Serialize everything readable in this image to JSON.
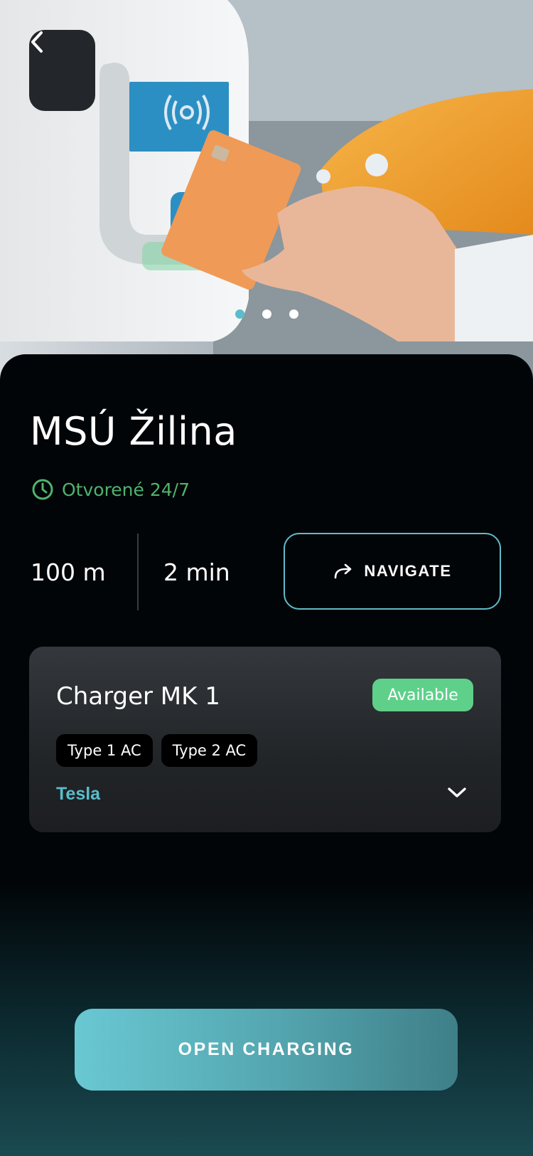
{
  "colors": {
    "accent": "#5bbccb",
    "open_status": "#4fb36d",
    "available_badge": "#5fd08a"
  },
  "hero": {
    "carousel": {
      "total": 3,
      "active_index": 0
    },
    "back_icon": "chevron-left-icon"
  },
  "station": {
    "name": "MSÚ Žilina",
    "hours_icon": "clock-icon",
    "hours": "Otvorené 24/7",
    "distance": "100 m",
    "duration": "2 min"
  },
  "navigate": {
    "icon": "share-arrow-icon",
    "label": "NAVIGATE"
  },
  "charger": {
    "name": "Charger MK 1",
    "status": "Available",
    "connectors": [
      "Type 1 AC",
      "Type 2 AC"
    ],
    "brand": "Tesla",
    "expand_icon": "chevron-down-icon"
  },
  "action": {
    "label": "OPEN CHARGING"
  }
}
